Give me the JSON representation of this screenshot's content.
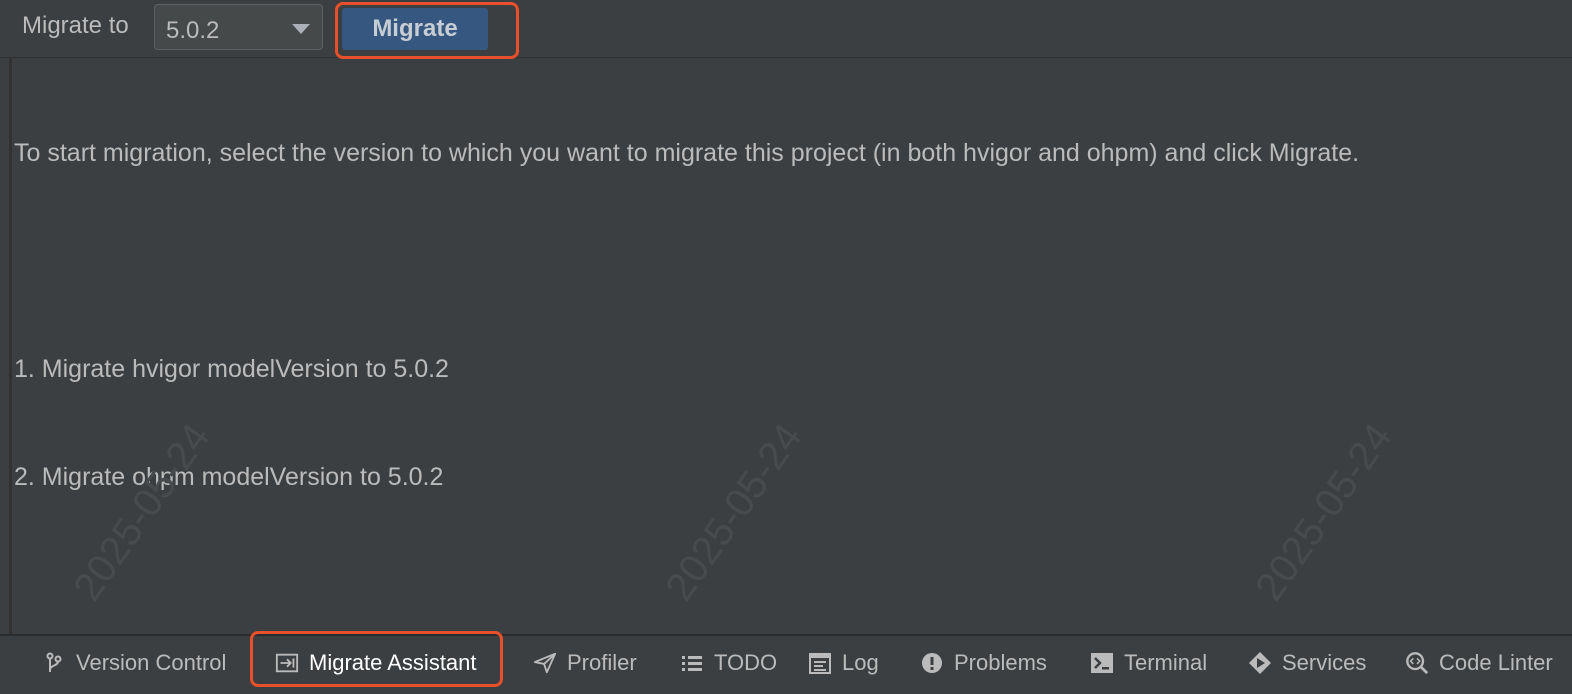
{
  "toolbar": {
    "label": "Migrate to",
    "version_value": "5.0.2",
    "migrate_button": "Migrate"
  },
  "content": {
    "intro": "To start migration, select the version to which you want to migrate this project (in both hvigor and ohpm) and click Migrate.",
    "steps": [
      "1. Migrate hvigor modelVersion to 5.0.2",
      "2. Migrate ohpm modelVersion to 5.0.2"
    ]
  },
  "watermarks": [
    "2025-05-24",
    "2025-05-24",
    "2025-05-24"
  ],
  "bottom_tabs": [
    {
      "label": "Version Control",
      "icon": "branch-icon"
    },
    {
      "label": "Migrate Assistant",
      "icon": "migrate-icon"
    },
    {
      "label": "Profiler",
      "icon": "paper-plane-icon"
    },
    {
      "label": "TODO",
      "icon": "list-icon"
    },
    {
      "label": "Log",
      "icon": "log-icon"
    },
    {
      "label": "Problems",
      "icon": "alert-icon"
    },
    {
      "label": "Terminal",
      "icon": "terminal-icon"
    },
    {
      "label": "Services",
      "icon": "play-icon"
    },
    {
      "label": "Code Linter",
      "icon": "linter-icon"
    }
  ],
  "colors": {
    "background": "#3c3f41",
    "button": "#365880",
    "highlight": "#e8502c",
    "text": "#bbbbbb"
  }
}
